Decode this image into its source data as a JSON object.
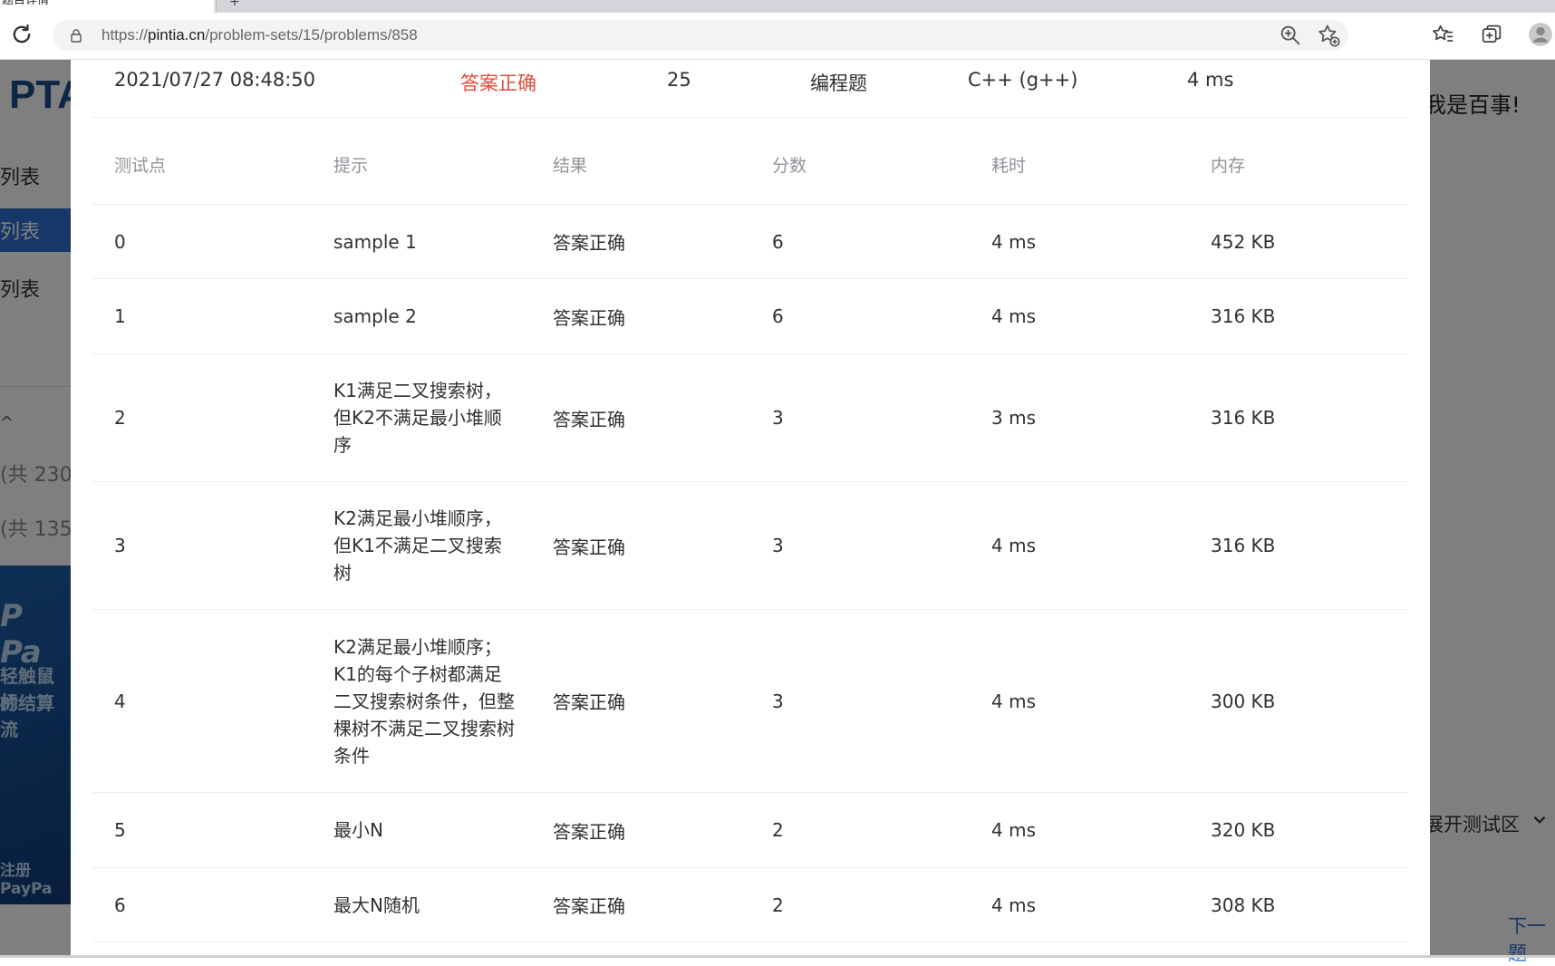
{
  "browser": {
    "tab_title": "题目详情",
    "new_tab_label": "+",
    "url_prefix": "https://",
    "url_host": "pintia.cn",
    "url_path": "/problem-sets/15/problems/858"
  },
  "background": {
    "logo": "PTA",
    "sidebar": [
      "列表",
      "列表",
      "列表"
    ],
    "sidebar_caret": "^",
    "count_1": "(共 230",
    "count_2": "(共 135(",
    "ad_lines": [
      "P Pa",
      "轻触鼠标",
      "的结算流",
      "注册PayPa"
    ],
    "right_title": "我是百事!",
    "right_expand": "展开测试区",
    "right_next": "下一题"
  },
  "summary": {
    "time": "2021/07/27 08:48:50",
    "status": "答案正确",
    "score": "25",
    "type": "编程题",
    "compiler": "C++ (g++)",
    "duration": "4 ms"
  },
  "table": {
    "headers": [
      "测试点",
      "提示",
      "结果",
      "分数",
      "耗时",
      "内存"
    ],
    "rows": [
      {
        "id": "0",
        "hint": "sample 1",
        "result": "答案正确",
        "score": "6",
        "time": "4 ms",
        "memory": "452 KB"
      },
      {
        "id": "1",
        "hint": "sample 2",
        "result": "答案正确",
        "score": "6",
        "time": "4 ms",
        "memory": "316 KB"
      },
      {
        "id": "2",
        "hint": "K1满足二叉搜索树，但K2不满足最小堆顺序",
        "result": "答案正确",
        "score": "3",
        "time": "3 ms",
        "memory": "316 KB"
      },
      {
        "id": "3",
        "hint": "K2满足最小堆顺序，但K1不满足二叉搜索树",
        "result": "答案正确",
        "score": "3",
        "time": "4 ms",
        "memory": "316 KB"
      },
      {
        "id": "4",
        "hint": "K2满足最小堆顺序；K1的每个子树都满足二叉搜索树条件，但整棵树不满足二叉搜索树条件",
        "result": "答案正确",
        "score": "3",
        "time": "4 ms",
        "memory": "300 KB"
      },
      {
        "id": "5",
        "hint": "最小N",
        "result": "答案正确",
        "score": "2",
        "time": "4 ms",
        "memory": "320 KB"
      },
      {
        "id": "6",
        "hint": "最大N随机",
        "result": "答案正确",
        "score": "2",
        "time": "4 ms",
        "memory": "308 KB"
      }
    ]
  },
  "colors": {
    "success_text": "#e14b3b",
    "header_text": "#909399",
    "body_text": "#303133",
    "row_border": "#ebeef5"
  }
}
